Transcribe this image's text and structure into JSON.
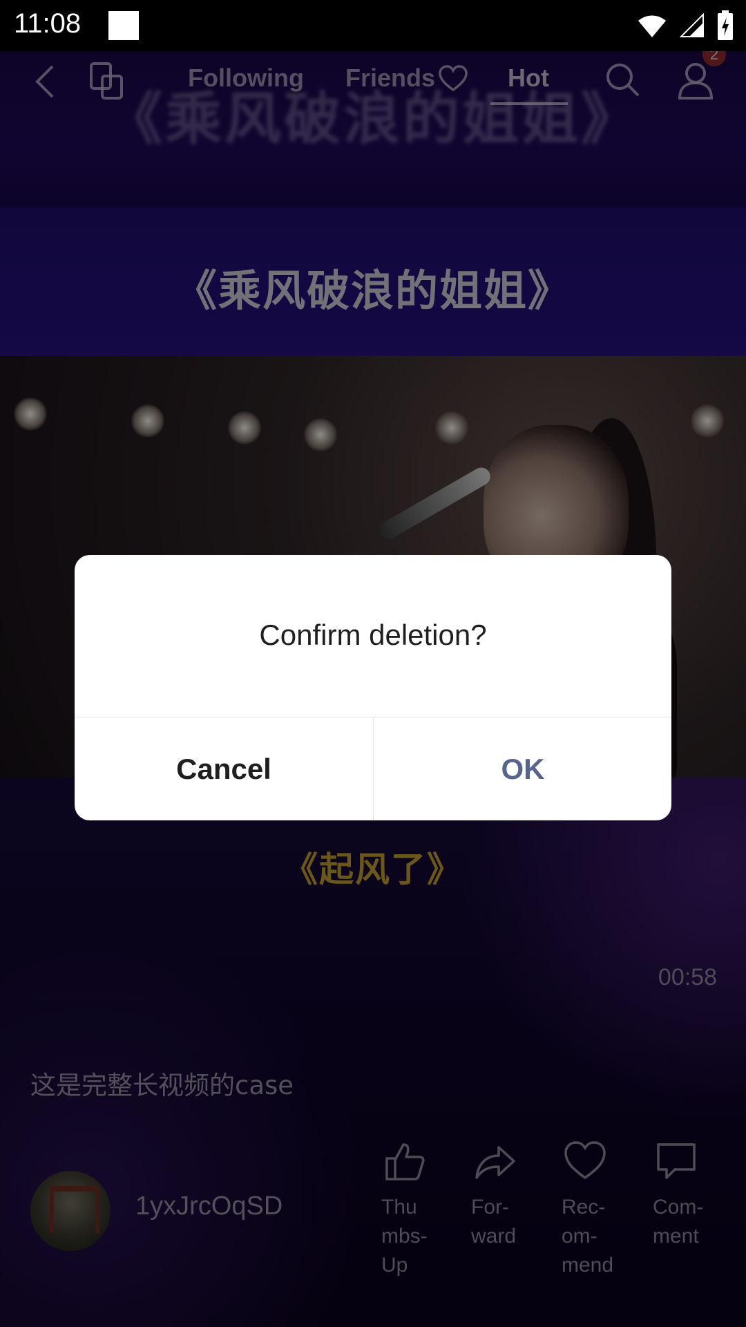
{
  "status_bar": {
    "time": "11:08"
  },
  "top_nav": {
    "tabs": [
      {
        "label": "Following"
      },
      {
        "label": "Friends"
      },
      {
        "label": "Hot",
        "active": true
      }
    ],
    "notification_count": "2"
  },
  "video": {
    "blurred_title": "《乘风破浪的姐姐》",
    "frame_title": "《乘风破浪的姐姐》",
    "caption": "《起风了》",
    "duration": "00:58",
    "description": "这是完整长视频的case",
    "author": "1yxJrcOqSD"
  },
  "actions": {
    "thumbs_up": "Thu\nmbs-\nUp",
    "forward": "For-\nward",
    "recommend": "Rec-\nom-\nmend",
    "comment": "Com-\nment"
  },
  "dialog": {
    "message": "Confirm deletion?",
    "cancel_label": "Cancel",
    "ok_label": "OK"
  },
  "colors": {
    "ok_accent": "#57648c",
    "badge": "#8a2a2e"
  },
  "icons": [
    "back-arrow-icon",
    "switch-icon",
    "heart-icon",
    "search-icon",
    "profile-icon",
    "thumbs-up-icon",
    "forward-icon",
    "recommend-heart-icon",
    "comment-icon"
  ]
}
